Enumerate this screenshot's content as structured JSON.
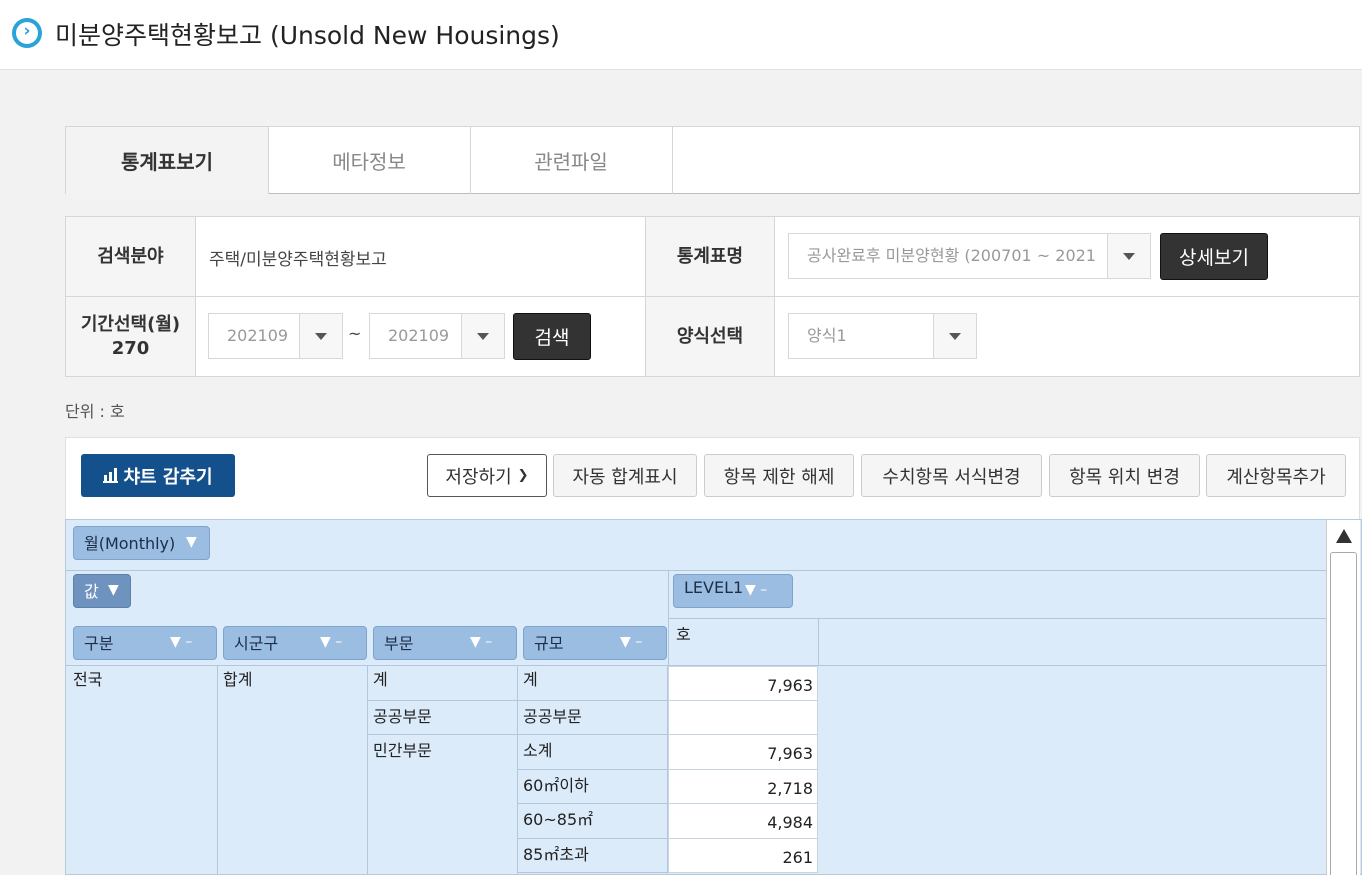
{
  "header": {
    "title": "미분양주택현황보고 (Unsold New Housings)"
  },
  "tabs": [
    {
      "label": "통계표보기"
    },
    {
      "label": "메타정보"
    },
    {
      "label": "관련파일"
    }
  ],
  "form": {
    "field_label": "검색분야",
    "field_value": "주택/미분양주택현황보고",
    "stat_label": "통계표명",
    "stat_value": "공사완료후 미분양현황 (200701 ~ 2021",
    "detail_button": "상세보기",
    "period_label": "기간선택(월)",
    "period_count": "270",
    "period_from": "202109",
    "period_tilde": "~",
    "period_to": "202109",
    "search_button": "검색",
    "format_label": "양식선택",
    "format_value": "양식1"
  },
  "unit_text": "단위 : 호",
  "toolbar": {
    "chart_toggle": "챠트 감추기",
    "save": "저장하기",
    "auto_sum": "자동 합계표시",
    "release_limit": "항목 제한 해제",
    "number_format": "수치항목 서식변경",
    "move_item": "항목 위치 변경",
    "add_calc": "계산항목추가"
  },
  "pivot": {
    "monthly_field": "월(Monthly)",
    "value_field": "값",
    "level_field": "LEVEL1",
    "row_fields": [
      "구분",
      "시군구",
      "부문",
      "규모"
    ],
    "column_header": "호",
    "region": "전국",
    "sigungu": "합계",
    "rows": [
      {
        "sector": "계",
        "size": "계",
        "value": "7,963"
      },
      {
        "sector": "공공부문",
        "size": "공공부문",
        "value": ""
      },
      {
        "sector": "민간부문",
        "size": "소계",
        "value": "7,963"
      },
      {
        "sector": "",
        "size": "60㎡이하",
        "value": "2,718"
      },
      {
        "sector": "",
        "size": "60~85㎡",
        "value": "4,984"
      },
      {
        "sector": "",
        "size": "85㎡초과",
        "value": "261"
      }
    ]
  }
}
